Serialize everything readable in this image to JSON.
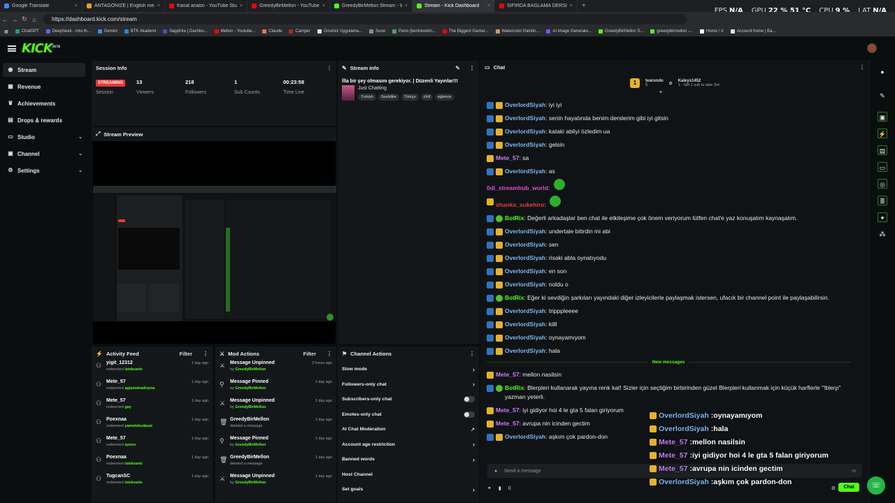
{
  "browser": {
    "tabs": [
      {
        "title": "Google Translate",
        "color": "#4285f4"
      },
      {
        "title": "ANTAGONIZE | English meaning -",
        "color": "#e8a317"
      },
      {
        "title": "Kanal analizi - YouTube Studio",
        "color": "#ff0000"
      },
      {
        "title": "GreedyBirMellon - YouTube",
        "color": "#ff0000"
      },
      {
        "title": "GreedyBirMellon Stream - Watch",
        "color": "#53fc18"
      },
      {
        "title": "Stream - Kick Dashboard",
        "color": "#53fc18"
      },
      {
        "title": "SIFIRDA BAĞLAMA DERSİ 5 ( Nota...",
        "color": "#ff0000"
      }
    ],
    "url": "https://dashboard.kick.com/stream",
    "bookmarks": [
      "ChatGPT",
      "DeepSeek - Into th...",
      "Gemini",
      "BTK Akademi",
      "Sapphire | Dashbo...",
      "Mellon - Youtube...",
      "Claude",
      "Camper",
      "Ücretsiz Uygulama...",
      "Suno",
      "Pano (bentrendim...",
      "The Biggest Gamer...",
      "Watercolor Paintin...",
      "AI Image Generato...",
      "GreedyBirMellon S...",
      "greedybirmellon -...",
      "Home / X",
      "Account home | Ba..."
    ],
    "stats": [
      {
        "label": "FPS",
        "value": "N/A"
      },
      {
        "label": "GPU",
        "value": "22 % 51 °C"
      },
      {
        "label": "CPU",
        "value": "9 %"
      },
      {
        "label": "LAT",
        "value": "N/A"
      }
    ]
  },
  "app": {
    "logo": "KICK",
    "logo_sup": "BETA"
  },
  "sidebar": [
    {
      "label": "Stream",
      "icon": "broadcast-icon",
      "glyph": "◉",
      "chev": ""
    },
    {
      "label": "Revenue",
      "icon": "revenue-icon",
      "glyph": "▦",
      "chev": ""
    },
    {
      "label": "Achievements",
      "icon": "trophy-icon",
      "glyph": "♛",
      "chev": ""
    },
    {
      "label": "Drops & rewards",
      "icon": "gift-icon",
      "glyph": "▤",
      "chev": ""
    },
    {
      "label": "Studio",
      "icon": "studio-icon",
      "glyph": "▭",
      "chev": "⌄"
    },
    {
      "label": "Channel",
      "icon": "channel-icon",
      "glyph": "▣",
      "chev": "⌄"
    },
    {
      "label": "Settings",
      "icon": "gear-icon",
      "glyph": "⚙",
      "chev": "⌄"
    }
  ],
  "session": {
    "title": "Session Info",
    "badge": "STREAMING",
    "badge_label": "Session",
    "stats": [
      {
        "value": "13",
        "label": "Viewers"
      },
      {
        "value": "218",
        "label": "Followers"
      },
      {
        "value": "1",
        "label": "Sub Counts"
      },
      {
        "value": "00:23:58",
        "label": "Time Live"
      }
    ]
  },
  "preview": {
    "title": "Stream Preview"
  },
  "stream_info": {
    "title": "Stream info",
    "stream_title": "İlla bir şey olmasını gerekiyor. | Düzenli Yayınlar!!!",
    "category": "Just Chatting",
    "tags": [
      "Turkish",
      "Soulslike",
      "Türkçe",
      "chill",
      "eglence"
    ]
  },
  "activity": {
    "title": "Activity Feed",
    "filter": "Filter",
    "items": [
      {
        "name": "yigit_12312",
        "action": "redeemed",
        "reward": "isteksarkı",
        "time": "1 day ago"
      },
      {
        "name": "Mete_57",
        "action": "redeemed",
        "reward": "aglamahadioyna",
        "time": "1 day ago"
      },
      {
        "name": "Mete_57",
        "action": "redeemed",
        "reward": "gay",
        "time": "1 day ago"
      },
      {
        "name": "Poexnaa",
        "action": "redeemed",
        "reward": "yametekudasai",
        "time": "1 day ago"
      },
      {
        "name": "Mete_57",
        "action": "redeemed",
        "reward": "aynen",
        "time": "1 day ago"
      },
      {
        "name": "Poexnaa",
        "action": "redeemed",
        "reward": "isteksarkı",
        "time": "1 day ago"
      },
      {
        "name": "TugcanSC",
        "action": "redeemed",
        "reward": "isteksarkı",
        "time": "1 day ago"
      }
    ]
  },
  "mod": {
    "title": "Mod Actions",
    "filter": "Filter",
    "items": [
      {
        "name": "Message Unpinned",
        "sub": "by",
        "who": "GreedyBirMellon",
        "time": "3 hours ago",
        "glyph": "⚔"
      },
      {
        "name": "Message Pinned",
        "sub": "by",
        "who": "GreedyBirMellon",
        "time": "1 day ago",
        "glyph": "⚲"
      },
      {
        "name": "Message Unpinned",
        "sub": "by",
        "who": "GreedyBirMellon",
        "time": "1 day ago",
        "glyph": "⚔"
      },
      {
        "name": "GreedyBirMellon",
        "sub": "deleted a message",
        "who": "",
        "time": "1 day ago",
        "glyph": "🗑"
      },
      {
        "name": "Message Pinned",
        "sub": "by",
        "who": "GreedyBirMellon",
        "time": "1 day ago",
        "glyph": "⚲"
      },
      {
        "name": "GreedyBirMellon",
        "sub": "deleted a message",
        "who": "",
        "time": "1 day ago",
        "glyph": "🗑"
      },
      {
        "name": "Message Unpinned",
        "sub": "by",
        "who": "GreedyBirMellon",
        "time": "1 day ago",
        "glyph": "⚔"
      }
    ]
  },
  "channel_actions": {
    "title": "Channel Actions",
    "rows": [
      {
        "label": "Slow mode",
        "end": "chevron"
      },
      {
        "label": "Followers-only chat",
        "end": "chevron"
      },
      {
        "label": "Subscribers-only chat",
        "end": "toggle"
      },
      {
        "label": "Emotes-only chat",
        "end": "toggle"
      },
      {
        "label": "AI Chat Moderation",
        "end": "external"
      },
      {
        "label": "Account age restriction",
        "end": "chevron"
      },
      {
        "label": "Banned words",
        "end": "chevron"
      },
      {
        "label": "Host Channel",
        "end": ""
      },
      {
        "label": "Set goals",
        "end": "chevron"
      }
    ]
  },
  "chat": {
    "title": "Chat",
    "leader1_name": "tearundo",
    "leader1_num": "5",
    "leader2_name": "Kaleys1452",
    "leader2_num": "1",
    "leader2_sub": "Gift 1 sub to take 3rd",
    "messages": [
      {
        "user": "OverlordSiyah",
        "color": "#7eb8f0",
        "text": "iyi iyi",
        "badges": [
          "b1",
          "b2"
        ]
      },
      {
        "user": "OverlordSiyah",
        "color": "#7eb8f0",
        "text": "senin hayatında benim derslerim gibi iyi gitsin",
        "badges": [
          "b1",
          "b2"
        ]
      },
      {
        "user": "OverlordSiyah",
        "color": "#7eb8f0",
        "text": "kataki abliyi özledim ua",
        "badges": [
          "b1",
          "b2"
        ]
      },
      {
        "user": "OverlordSiyah",
        "color": "#7eb8f0",
        "text": "gelsin",
        "badges": [
          "b1",
          "b2"
        ]
      },
      {
        "user": "Mete_57",
        "color": "#c77dff",
        "text": "sa",
        "badges": [
          "b2"
        ]
      },
      {
        "user": "OverlordSiyah",
        "color": "#7eb8f0",
        "text": "as",
        "badges": [
          "b1",
          "b2"
        ]
      },
      {
        "user": "0di_streamhub_world",
        "color": "#d94fd3",
        "text": "",
        "badges": [],
        "emote": true
      },
      {
        "user": "shanks_sukehiro",
        "color": "#e63c3c",
        "text": "",
        "badges": [
          "b2"
        ],
        "emote": true
      },
      {
        "user": "BotRix",
        "color": "#53fc18",
        "text": "Değerli arkadaşlar ben chat ile etkileşime çok önem veriyorum lütfen chat'e yaz konuşalım kaynaşalım.",
        "badges": [
          "b1",
          "b3"
        ]
      },
      {
        "user": "OverlordSiyah",
        "color": "#7eb8f0",
        "text": "undertale bitirdin mi abi",
        "badges": [
          "b1",
          "b2"
        ]
      },
      {
        "user": "OverlordSiyah",
        "color": "#7eb8f0",
        "text": "sen",
        "badges": [
          "b1",
          "b2"
        ]
      },
      {
        "user": "OverlordSiyah",
        "color": "#7eb8f0",
        "text": "risaki abla oynatıyodu",
        "badges": [
          "b1",
          "b2"
        ]
      },
      {
        "user": "OverlordSiyah",
        "color": "#7eb8f0",
        "text": "en son",
        "badges": [
          "b1",
          "b2"
        ]
      },
      {
        "user": "OverlordSiyah",
        "color": "#7eb8f0",
        "text": "noldu o",
        "badges": [
          "b1",
          "b2"
        ]
      },
      {
        "user": "BotRix",
        "color": "#53fc18",
        "text": "Eğer ki sevdiğin şarkıları yayındaki diğer izleyicilerle paylaşmak istersen, ufacık bir channel point ile paylaşabilirsin.",
        "badges": [
          "b1",
          "b3"
        ]
      },
      {
        "user": "OverlordSiyah",
        "color": "#7eb8f0",
        "text": "tripppleeee",
        "badges": [
          "b1",
          "b2"
        ]
      },
      {
        "user": "OverlordSiyah",
        "color": "#7eb8f0",
        "text": "killl",
        "badges": [
          "b1",
          "b2"
        ]
      },
      {
        "user": "OverlordSiyah",
        "color": "#7eb8f0",
        "text": "oynayamıyom",
        "badges": [
          "b1",
          "b2"
        ]
      },
      {
        "user": "OverlordSiyah",
        "color": "#7eb8f0",
        "text": "hala",
        "badges": [
          "b1",
          "b2"
        ]
      }
    ],
    "new_label": "New messages",
    "new_messages": [
      {
        "user": "Mete_57",
        "color": "#c77dff",
        "text": "mellon nasilsin",
        "badges": [
          "b2"
        ]
      },
      {
        "user": "BotRix",
        "color": "#53fc18",
        "text": "Blerpleri kullanarak yayına renk kat! Sizler için seçtiğim birbirinden güzel Blerpleri kullanmak için küçük harflerle \"!blerp\" yazman yeterli.",
        "badges": [
          "b1",
          "b3"
        ]
      },
      {
        "user": "Mete_57",
        "color": "#c77dff",
        "text": "iyi gidiyor hoi 4 le gta 5 falan giriyorum",
        "badges": [
          "b2"
        ]
      },
      {
        "user": "Mete_57",
        "color": "#c77dff",
        "text": "avrupa nin icinden gectim",
        "badges": [
          "b2"
        ]
      },
      {
        "user": "OverlordSiyah",
        "color": "#7eb8f0",
        "text": "aşkım çok pardon-don",
        "badges": [
          "b1",
          "b2"
        ]
      }
    ],
    "overlay": [
      {
        "user": "OverlordSiyah",
        "color": "#7eb8f0",
        "text": "oynayamıyom"
      },
      {
        "user": "OverlordSiyah",
        "color": "#7eb8f0",
        "text": "hala"
      },
      {
        "user": "Mete_57",
        "color": "#c77dff",
        "text": "mellon nasilsin"
      },
      {
        "user": "Mete_57",
        "color": "#c77dff",
        "text": "iyi gidiyor hoi 4 le gta 5 falan giriyorum"
      },
      {
        "user": "Mete_57",
        "color": "#c77dff",
        "text": "avrupa nin icinden gectim"
      },
      {
        "user": "OverlordSiyah",
        "color": "#7eb8f0",
        "text": "aşkım çok pardon-don"
      }
    ],
    "placeholder": "Send a message",
    "points": "0",
    "send": "Chat"
  }
}
